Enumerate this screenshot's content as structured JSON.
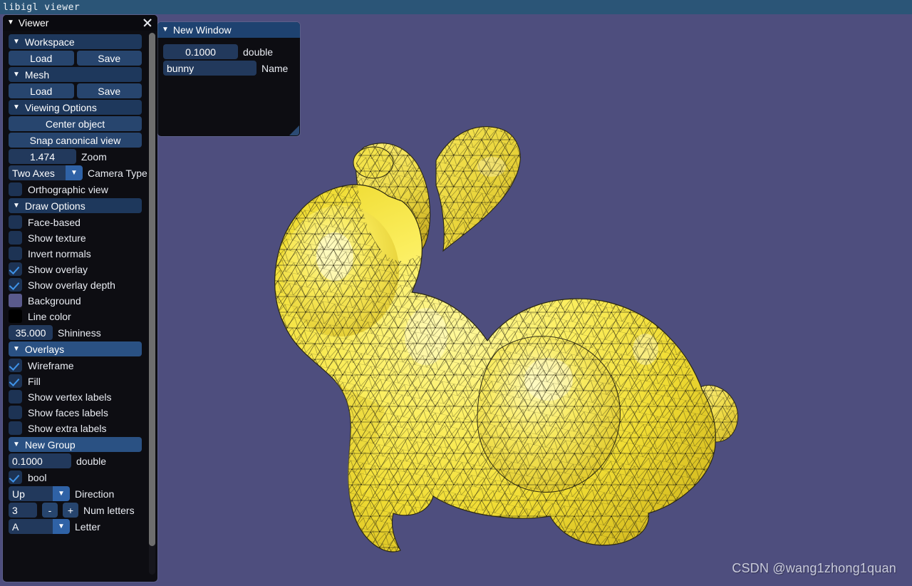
{
  "window": {
    "title": "libigl viewer",
    "titlebar_color": "#2b5577",
    "background_color": "#4e4e7e"
  },
  "viewport": {
    "model_name": "bunny",
    "mesh_fill_color": "#f2e33a",
    "mesh_line_color": "#000000",
    "watermark": "CSDN @wang1zhong1quan"
  },
  "viewer_panel": {
    "title": "Viewer",
    "caret": "▼",
    "close_icon": "close-icon",
    "sections": {
      "workspace": {
        "label": "Workspace",
        "load": "Load",
        "save": "Save"
      },
      "mesh": {
        "label": "Mesh",
        "load": "Load",
        "save": "Save"
      },
      "viewing_options": {
        "label": "Viewing Options",
        "center_object": "Center object",
        "snap_canonical_view": "Snap canonical view",
        "zoom_value": "1.474",
        "zoom_label": "Zoom",
        "camera_type_value": "Two Axes",
        "camera_type_label": "Camera Type",
        "orthographic_view": "Orthographic view",
        "orthographic_checked": false
      },
      "draw_options": {
        "label": "Draw Options",
        "face_based": "Face-based",
        "face_based_checked": false,
        "show_texture": "Show texture",
        "show_texture_checked": false,
        "invert_normals": "Invert normals",
        "invert_normals_checked": false,
        "show_overlay": "Show overlay",
        "show_overlay_checked": true,
        "show_overlay_depth": "Show overlay depth",
        "show_overlay_depth_checked": true,
        "background_label": "Background",
        "background_color": "#5a5a8c",
        "line_color_label": "Line color",
        "line_color": "#000000",
        "shininess_value": "35.000",
        "shininess_label": "Shininess"
      },
      "overlays": {
        "label": "Overlays",
        "wireframe": "Wireframe",
        "wireframe_checked": true,
        "fill": "Fill",
        "fill_checked": true,
        "show_vertex_labels": "Show vertex labels",
        "show_vertex_labels_checked": false,
        "show_faces_labels": "Show faces labels",
        "show_faces_labels_checked": false,
        "show_extra_labels": "Show extra labels",
        "show_extra_labels_checked": false
      },
      "new_group": {
        "label": "New Group",
        "double_value": "0.1000",
        "double_label": "double",
        "bool_label": "bool",
        "bool_checked": true,
        "direction_value": "Up",
        "direction_label": "Direction",
        "num_letters_value": "3",
        "num_letters_minus": "-",
        "num_letters_plus": "+",
        "num_letters_label": "Num letters",
        "letter_value": "A",
        "letter_label": "Letter"
      }
    }
  },
  "new_window_panel": {
    "title": "New Window",
    "caret": "▼",
    "double_value": "0.1000",
    "double_label": "double",
    "name_value": "bunny",
    "name_label": "Name"
  }
}
